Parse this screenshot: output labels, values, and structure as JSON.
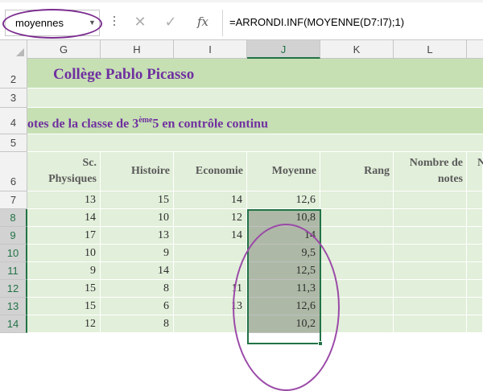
{
  "formula_bar": {
    "name_box": "moyennes",
    "cancel_icon": "✕",
    "enter_icon": "✓",
    "fx_label": "fx",
    "formula": "=ARRONDI.INF(MOYENNE(D7:I7);1)"
  },
  "columns": [
    "G",
    "H",
    "I",
    "J",
    "K",
    "L"
  ],
  "rows": [
    "2",
    "3",
    "4",
    "5",
    "6",
    "7",
    "8",
    "9",
    "10",
    "11",
    "12",
    "13",
    "14"
  ],
  "sheet": {
    "title": "Collège Pablo Picasso",
    "subtitle_pre": "otes de la classe de 3",
    "subtitle_sup": "ème",
    "subtitle_post": "5 en contrôle continu",
    "headers": {
      "g_line1": "Sc.",
      "g_line2": "Physiques",
      "h": "Histoire",
      "i": "Economie",
      "j": "Moyenne",
      "k": "Rang",
      "l_line1": "Nombre de",
      "l_line2": "notes",
      "m_partial": "N"
    },
    "data": [
      {
        "g": "13",
        "h": "15",
        "i": "14",
        "j": "12,6"
      },
      {
        "g": "14",
        "h": "10",
        "i": "12",
        "j": "10,8"
      },
      {
        "g": "17",
        "h": "13",
        "i": "14",
        "j": "14"
      },
      {
        "g": "10",
        "h": "9",
        "i": "",
        "j": "9,5"
      },
      {
        "g": "9",
        "h": "14",
        "i": "",
        "j": "12,5"
      },
      {
        "g": "15",
        "h": "8",
        "i": "11",
        "j": "11,3"
      },
      {
        "g": "15",
        "h": "6",
        "i": "13",
        "j": "12,6"
      },
      {
        "g": "12",
        "h": "8",
        "i": "",
        "j": "10,2"
      }
    ]
  },
  "colors": {
    "band_light": "#e2efda",
    "band_dark": "#c6e0b4",
    "title_purple": "#7030a0",
    "selected_range": "#adb9a6",
    "annotation": "#7b2c8f",
    "excel_green": "#217346"
  }
}
